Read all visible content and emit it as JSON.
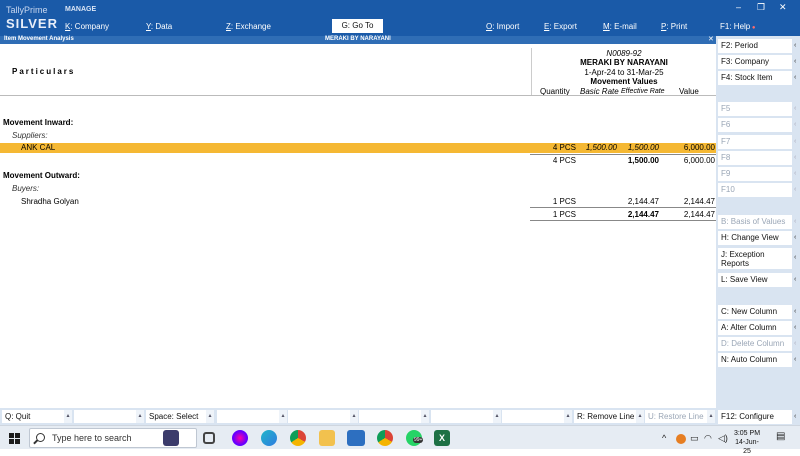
{
  "header": {
    "brand_top": "TallyPrime",
    "brand_main": "SILVER",
    "manage": "MANAGE",
    "menus": [
      {
        "key": "K",
        "label": ": Company"
      },
      {
        "key": "Y",
        "label": ": Data"
      },
      {
        "key": "Z",
        "label": ": Exchange"
      },
      {
        "key": "O",
        "label": ": Import"
      },
      {
        "key": "E",
        "label": ": Export"
      },
      {
        "key": "M",
        "label": ": E-mail"
      },
      {
        "key": "P",
        "label": ": Print"
      },
      {
        "key": "F1",
        "label": ": Help"
      }
    ],
    "goto": "G: Go To"
  },
  "subbar": {
    "report_name": "Item Movement Analysis",
    "company": "MERAKI BY NARAYANI",
    "close": "✕"
  },
  "report": {
    "particulars": "Particulars",
    "code": "N0089-92",
    "company_name": "MERAKI BY NARAYANI",
    "period": "1-Apr-24 to 31-Mar-25",
    "values_title": "Movement Values",
    "columns": [
      "Quantity",
      "Basic Rate",
      "Effective Rate",
      "Value"
    ],
    "inward": {
      "title": "Movement Inward:",
      "group": "Suppliers:",
      "rows": [
        {
          "name": "ANK CAL",
          "qty": "4 PCS",
          "basic": "1,500.00",
          "effective": "1,500.00",
          "value": "6,000.00"
        }
      ],
      "total": {
        "qty": "4 PCS",
        "effective": "1,500.00",
        "value": "6,000.00"
      }
    },
    "outward": {
      "title": "Movement Outward:",
      "group": "Buyers:",
      "rows": [
        {
          "name": "Shradha Golyan",
          "qty": "1 PCS",
          "basic": "",
          "effective": "2,144.47",
          "value": "2,144.47"
        }
      ],
      "total": {
        "qty": "1 PCS",
        "effective": "2,144.47",
        "value": "2,144.47"
      }
    }
  },
  "right_panel": {
    "buttons": [
      {
        "key": "F2",
        "label": "F2: Period",
        "enabled": true
      },
      {
        "key": "F3",
        "label": "F3: Company",
        "enabled": true
      },
      {
        "key": "F4",
        "label": "F4: Stock Item",
        "enabled": true
      },
      {
        "key": "F5",
        "label": "F5",
        "enabled": false
      },
      {
        "key": "F6",
        "label": "F6",
        "enabled": false
      },
      {
        "key": "F7",
        "label": "F7",
        "enabled": false
      },
      {
        "key": "F8",
        "label": "F8",
        "enabled": false
      },
      {
        "key": "F9",
        "label": "F9",
        "enabled": false
      },
      {
        "key": "F10",
        "label": "F10",
        "enabled": false
      },
      {
        "key": "B",
        "label": "B: Basis of Values",
        "enabled": false
      },
      {
        "key": "H",
        "label": "H: Change View",
        "enabled": true
      },
      {
        "key": "J",
        "label": "J: Exception Reports",
        "enabled": true
      },
      {
        "key": "L",
        "label": "L: Save View",
        "enabled": true
      },
      {
        "key": "C",
        "label": "C: New Column",
        "enabled": true
      },
      {
        "key": "A",
        "label": "A: Alter Column",
        "enabled": true
      },
      {
        "key": "D",
        "label": "D: Delete Column",
        "enabled": false
      },
      {
        "key": "N",
        "label": "N: Auto Column",
        "enabled": true
      },
      {
        "key": "F12",
        "label": "F12: Configure",
        "enabled": true
      }
    ]
  },
  "bottom_bar": {
    "quit": "Q: Quit",
    "select": "Space: Select",
    "remove_line": "R: Remove Line",
    "restore_line": "U: Restore Line"
  },
  "taskbar": {
    "search_placeholder": "Type here to search",
    "time": "3:05 PM",
    "date": "14-Jun-25",
    "badge": "99+"
  },
  "colors": {
    "header_blue": "#1a5aa8",
    "highlight": "#f5b833",
    "panel": "#d9e4f1"
  }
}
